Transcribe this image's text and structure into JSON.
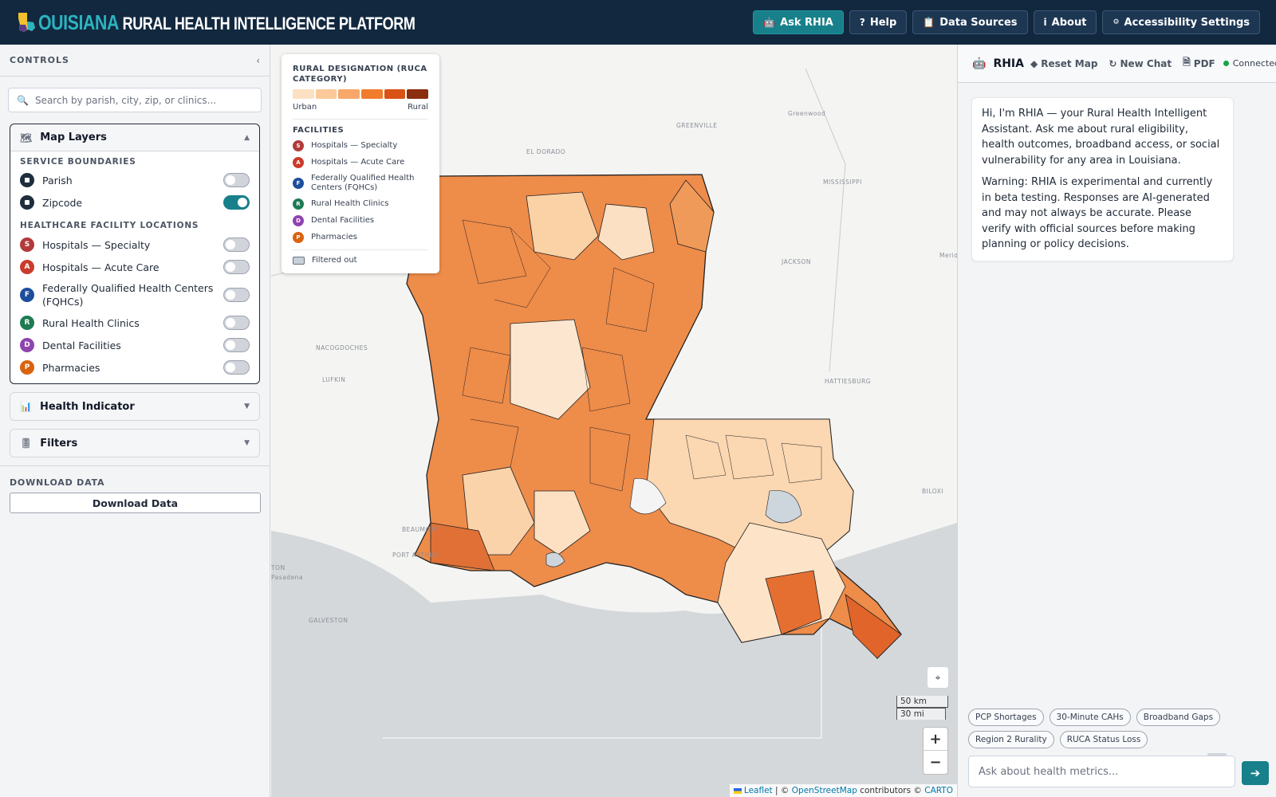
{
  "header": {
    "logo_state": "OUISIANA",
    "logo_rest": "RURAL HEALTH INTELLIGENCE PLATFORM",
    "nav": [
      {
        "label": "Ask RHIA",
        "icon": "robot-icon"
      },
      {
        "label": "Help",
        "icon": "question-icon"
      },
      {
        "label": "Data Sources",
        "icon": "clipboard-icon"
      },
      {
        "label": "About",
        "icon": "info-icon"
      },
      {
        "label": "Accessibility Settings",
        "icon": "accessibility-icon"
      }
    ]
  },
  "sidebar": {
    "title": "CONTROLS",
    "search_placeholder": "Search by parish, city, zip, or clinics...",
    "layers_title": "Map Layers",
    "service_boundaries_title": "SERVICE BOUNDARIES",
    "boundaries": [
      {
        "label": "Parish",
        "on": false
      },
      {
        "label": "Zipcode",
        "on": true
      }
    ],
    "facilities_title": "HEALTHCARE FACILITY LOCATIONS",
    "facilities": [
      {
        "letter": "S",
        "label": "Hospitals — Specialty",
        "color": "#b23a3a",
        "on": false
      },
      {
        "letter": "A",
        "label": "Hospitals — Acute Care",
        "color": "#c93c2c",
        "on": false
      },
      {
        "letter": "F",
        "label": "Federally Qualified Health Centers (FQHCs)",
        "color": "#1d4e9e",
        "on": false
      },
      {
        "letter": "R",
        "label": "Rural Health Clinics",
        "color": "#1e7b53",
        "on": false
      },
      {
        "letter": "D",
        "label": "Dental Facilities",
        "color": "#8e44ad",
        "on": false
      },
      {
        "letter": "P",
        "label": "Pharmacies",
        "color": "#d9630f",
        "on": false
      }
    ],
    "health_indicator_title": "Health Indicator",
    "filters_title": "Filters",
    "download_title": "DOWNLOAD DATA",
    "download_button": "Download Data"
  },
  "map": {
    "legend": {
      "title": "RURAL DESIGNATION (RUCA CATEGORY)",
      "ramp": [
        "#fde0c2",
        "#fbc99a",
        "#f7a868",
        "#f07c2c",
        "#d95314",
        "#8a2e0e"
      ],
      "urban_label": "Urban",
      "rural_label": "Rural",
      "facilities_title": "FACILITIES",
      "filtered_out": "Filtered out"
    },
    "labels": {
      "greenville": "GREENVILLE",
      "greenwood": "Greenwood",
      "el_dorado": "EL DORADO",
      "mississippi": "MISSISSIPPI",
      "jackson": "JACKSON",
      "meridian": "Meridi",
      "nacogdoches": "NACOGDOCHES",
      "lufkin": "LUFKIN",
      "hattiesburg": "HATTIESBURG",
      "biloxi": "BILOXI",
      "beaumont": "BEAUMONT",
      "port_arthur": "PORT ARTHUR",
      "houston": "TON",
      "pasadena": "Pasadena",
      "galveston": "GALVESTON"
    },
    "scale_km": "50 km",
    "scale_mi": "30 mi",
    "zoom_in": "+",
    "zoom_out": "−",
    "attribution": {
      "leaflet": "Leaflet",
      "sep": "| ©",
      "osm": "OpenStreetMap",
      "contrib": "contributors ©",
      "carto": "CARTO"
    }
  },
  "chat": {
    "title": "RHIA",
    "reset": "Reset Map",
    "new_chat": "New Chat",
    "pdf": "PDF",
    "status": "Connected",
    "messages": [
      "Hi, I'm RHIA — your Rural Health Intelligent Assistant. Ask me about rural eligibility, health outcomes, broadband access, or social vulnerability for any area in Louisiana.",
      "Warning: RHIA is experimental and currently in beta testing. Responses are AI-generated and may not always be accurate. Please verify with official sources before making planning or policy decisions."
    ],
    "chips": [
      "PCP Shortages",
      "30-Minute CAHs",
      "Broadband Gaps",
      "Region 2 Rurality",
      "RUCA Status Loss"
    ],
    "input_placeholder": "Ask about health metrics..."
  }
}
